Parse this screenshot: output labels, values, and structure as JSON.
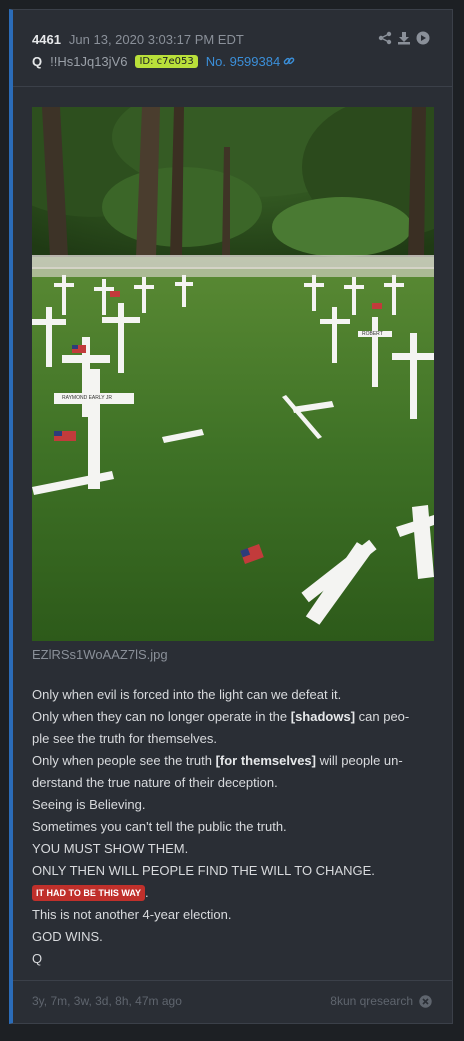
{
  "post": {
    "number": "4461",
    "date": "Jun 13, 2020 3:03:17 PM EDT",
    "author": "Q",
    "tripcode": "!!Hs1Jq13jV6",
    "id_badge": "ID: c7e053",
    "post_link": "No. 9599384",
    "id_badge_color": "#b9e03a",
    "accent_color": "#2b6cb8"
  },
  "actions": {
    "share_icon": "share-icon",
    "download_icon": "download-icon",
    "forward_icon": "arrow-circle-icon"
  },
  "image": {
    "filename": "EZlRSs1WoAAZ7lS.jpg",
    "cross_labels": [
      "RAYMOND EARLY JR",
      "ROBERT"
    ]
  },
  "message": {
    "l1": "Only when evil is forced into the light can we defeat it.",
    "l2a": "Only when they can no longer operate in the ",
    "l2b": "[shadows]",
    "l2c": " can peo-",
    "l3": "ple see the truth for themselves.",
    "l4a": "Only when people see the truth ",
    "l4b": "[for themselves]",
    "l4c": " will people un-",
    "l5": "derstand the true nature of their deception.",
    "l6": "Seeing is Believing.",
    "l7": "Sometimes you can't tell the public the truth.",
    "l8": "YOU MUST SHOW THEM.",
    "l9": "ONLY THEN WILL PEOPLE FIND THE WILL TO CHANGE.",
    "l10_badge": "IT HAD TO BE THIS WAY",
    "l10_after": ".",
    "l11": "This is not another 4-year election.",
    "l12": "GOD WINS.",
    "l13": "Q"
  },
  "footer": {
    "age": "3y, 7m, 3w, 3d, 8h, 47m ago",
    "source": "8kun qresearch",
    "close_icon": "close-circle-icon"
  }
}
